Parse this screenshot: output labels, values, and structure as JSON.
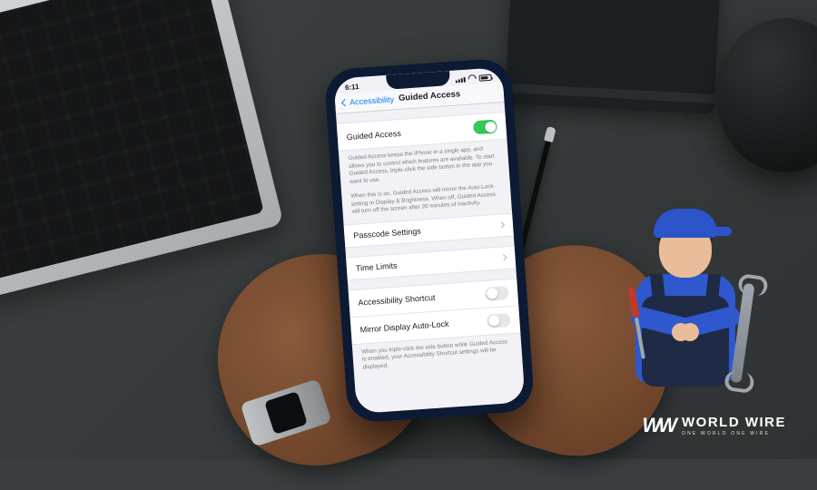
{
  "status": {
    "time": "6:11"
  },
  "nav": {
    "back": "Accessibility",
    "title": "Guided Access"
  },
  "rows": {
    "main_toggle": "Guided Access",
    "passcode": "Passcode Settings",
    "time_limits": "Time Limits",
    "shortcut": "Accessibility Shortcut",
    "mirror": "Mirror Display Auto-Lock"
  },
  "footers": {
    "f1": "Guided Access keeps the iPhone in a single app, and allows you to control which features are available. To start Guided Access, triple-click the side button in the app you want to use.",
    "f2": "When this is on, Guided Access will mirror the Auto-Lock setting in Display & Brightness. When off, Guided Access will turn off the screen after 20 minutes of inactivity.",
    "f3": "When you triple-click the side button while Guided Access is enabled, your Accessibility Shortcut settings will be displayed."
  },
  "brand": {
    "mark": "WW",
    "name": "WORLD WIRE",
    "tag": "ONE WORLD ONE WIRE"
  }
}
